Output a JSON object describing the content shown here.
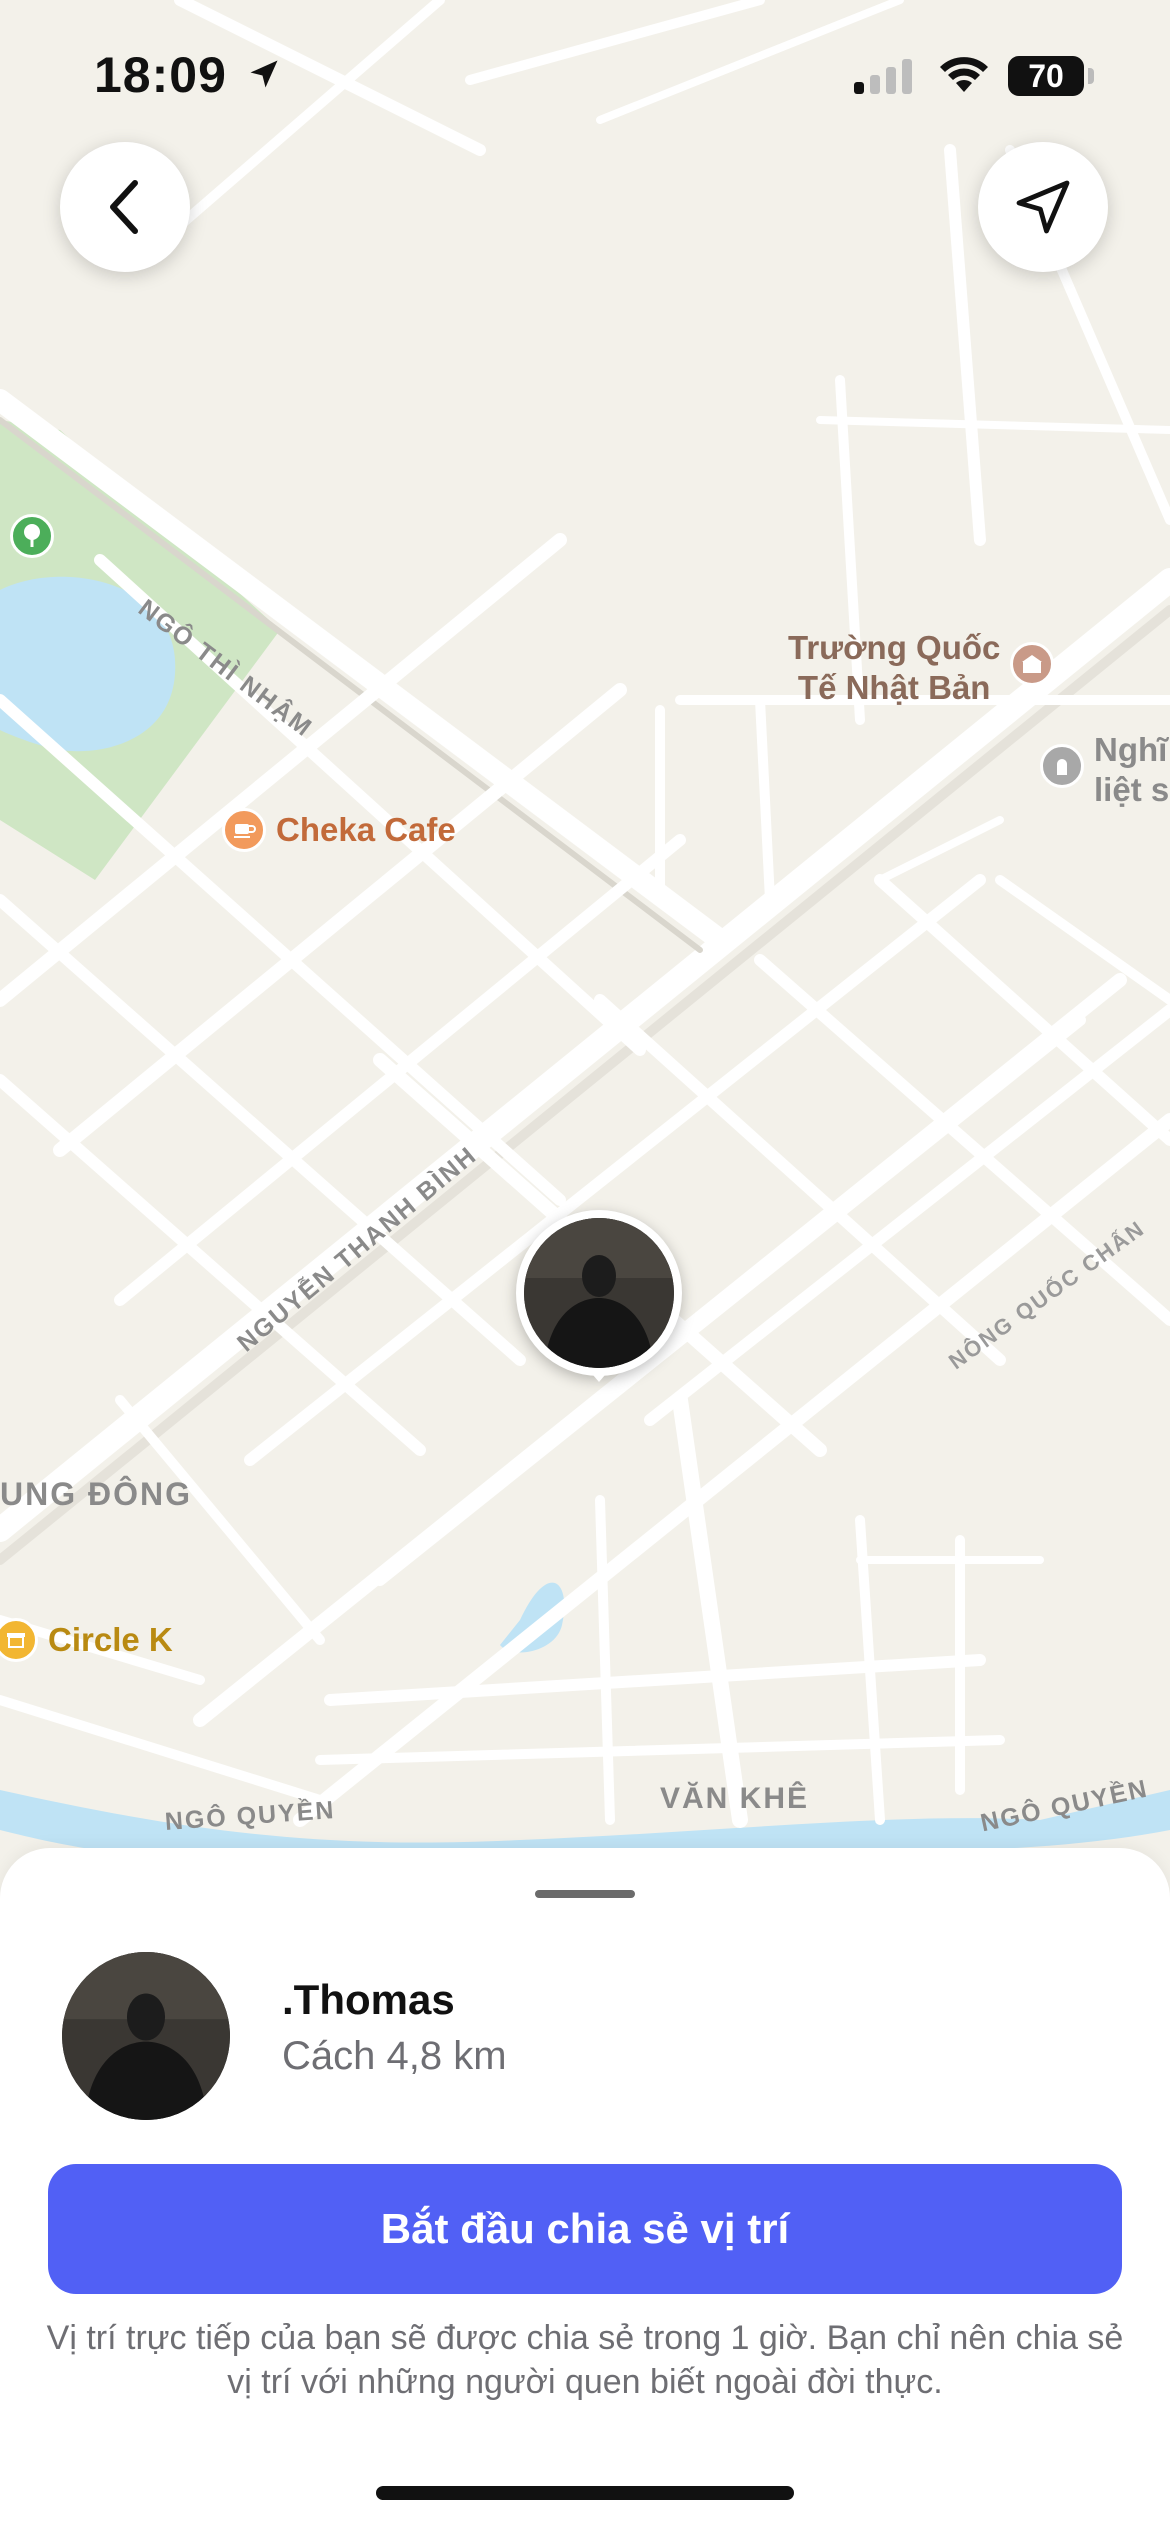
{
  "status_bar": {
    "time": "18:09",
    "battery": "70"
  },
  "map": {
    "pois": [
      {
        "name": "Cheka Cafe",
        "color": "#c26a3a",
        "icon": "cafe-icon"
      },
      {
        "name": "Circle K",
        "color": "#b98a12",
        "icon": "store-icon"
      },
      {
        "name_line1": "Trường Quốc",
        "name_line2": "Tế Nhật Bản",
        "color": "#8a6a5a",
        "icon": "school-icon"
      },
      {
        "name_line1": "Nghĩ",
        "name_line2": "liệt s",
        "color": "#8a8a8a",
        "icon": "memorial-icon"
      }
    ],
    "streets": {
      "ngo_thi_nham": "NGÔ THÌ NHẬM",
      "nguyen_thanh_binh": "NGUYỄN THANH BÌNH",
      "nong_quoc_chan": "NÔNG QUỐC CHẤN",
      "ung_dong": "UNG ĐÔNG",
      "ngo_quyen_left": "NGÔ QUYỀN",
      "van_khe": "VĂN KHÊ",
      "ngo_quyen_right": "NGÔ QUYỀN"
    }
  },
  "sheet": {
    "user_name": ".Thomas",
    "distance": "Cách 4,8 km",
    "cta_label": "Bắt đầu chia sẻ vị trí",
    "note": "Vị trí trực tiếp của bạn sẽ được chia sẻ trong 1 giờ. Bạn chỉ nên chia sẻ vị trí với những người quen biết ngoài đời thực."
  },
  "colors": {
    "accent": "#5160f5",
    "map_bg": "#f3f1ea",
    "water": "#bfe3f5",
    "park": "#cfe6c4"
  }
}
